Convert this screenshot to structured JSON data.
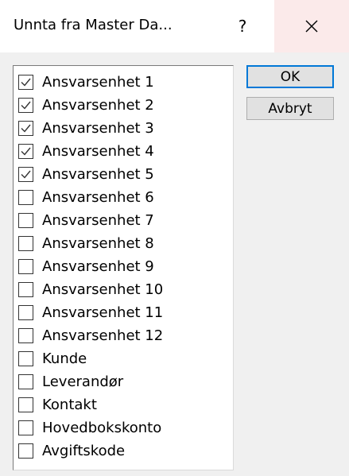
{
  "dialog": {
    "title": "Unnta fra Master Da...",
    "help_label": "?",
    "close_icon": "close-icon"
  },
  "list": {
    "items": [
      {
        "label": "Ansvarsenhet 1",
        "checked": true
      },
      {
        "label": "Ansvarsenhet 2",
        "checked": true
      },
      {
        "label": "Ansvarsenhet 3",
        "checked": true
      },
      {
        "label": "Ansvarsenhet 4",
        "checked": true
      },
      {
        "label": "Ansvarsenhet 5",
        "checked": true
      },
      {
        "label": "Ansvarsenhet 6",
        "checked": false
      },
      {
        "label": "Ansvarsenhet 7",
        "checked": false
      },
      {
        "label": "Ansvarsenhet 8",
        "checked": false
      },
      {
        "label": "Ansvarsenhet 9",
        "checked": false
      },
      {
        "label": "Ansvarsenhet 10",
        "checked": false
      },
      {
        "label": "Ansvarsenhet 11",
        "checked": false
      },
      {
        "label": "Ansvarsenhet 12",
        "checked": false
      },
      {
        "label": "Kunde",
        "checked": false
      },
      {
        "label": "Leverandør",
        "checked": false
      },
      {
        "label": "Kontakt",
        "checked": false
      },
      {
        "label": "Hovedbokskonto",
        "checked": false
      },
      {
        "label": "Avgiftskode",
        "checked": false
      }
    ]
  },
  "buttons": {
    "ok_label": "OK",
    "cancel_label": "Avbryt"
  },
  "colors": {
    "client_background": "#f0f0f0",
    "close_hover": "#fbeaea",
    "default_button_border": "#0078d7",
    "button_face": "#e1e1e1"
  }
}
